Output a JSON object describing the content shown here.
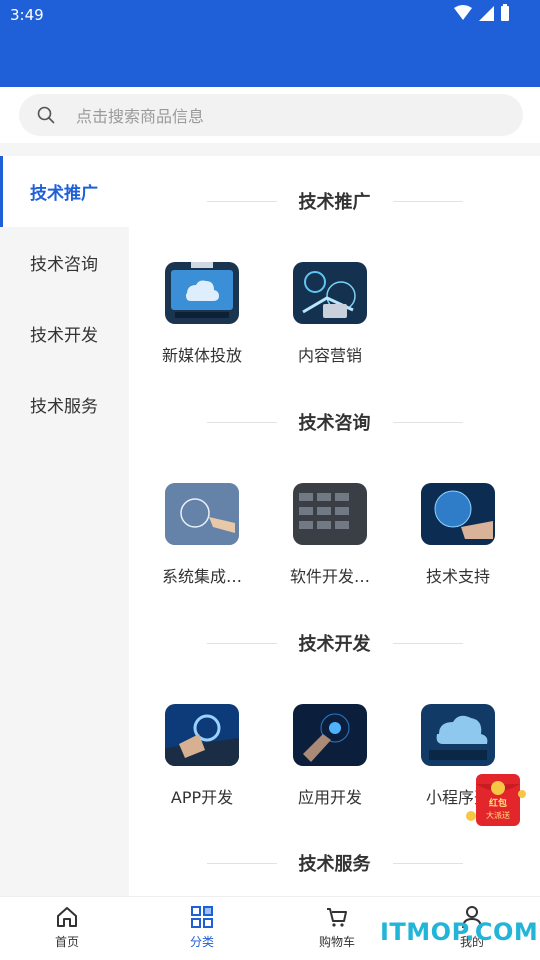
{
  "status_bar": {
    "time": "3:49"
  },
  "search": {
    "placeholder": "点击搜索商品信息"
  },
  "sidebar": {
    "items": [
      {
        "label": "技术推广",
        "active": true
      },
      {
        "label": "技术咨询",
        "active": false
      },
      {
        "label": "技术开发",
        "active": false
      },
      {
        "label": "技术服务",
        "active": false
      }
    ]
  },
  "sections": [
    {
      "title": "技术推广",
      "items": [
        {
          "label": "新媒体投放"
        },
        {
          "label": "内容营销"
        }
      ]
    },
    {
      "title": "技术咨询",
      "items": [
        {
          "label": "系统集成…"
        },
        {
          "label": "软件开发…"
        },
        {
          "label": "技术支持"
        }
      ]
    },
    {
      "title": "技术开发",
      "items": [
        {
          "label": "APP开发"
        },
        {
          "label": "应用开发"
        },
        {
          "label": "小程序开"
        }
      ]
    },
    {
      "title": "技术服务",
      "items": []
    }
  ],
  "tabbar": {
    "items": [
      {
        "label": "首页",
        "icon": "home-icon"
      },
      {
        "label": "分类",
        "icon": "category-icon",
        "active": true
      },
      {
        "label": "购物车",
        "icon": "cart-icon"
      },
      {
        "label": "我的",
        "icon": "user-icon"
      }
    ]
  },
  "promo": {
    "label": "红包大派送"
  },
  "watermark": {
    "text": "ITMOP.COM"
  },
  "colors": {
    "primary": "#1f5fd8",
    "sidebar_bg": "#f5f5f5"
  }
}
